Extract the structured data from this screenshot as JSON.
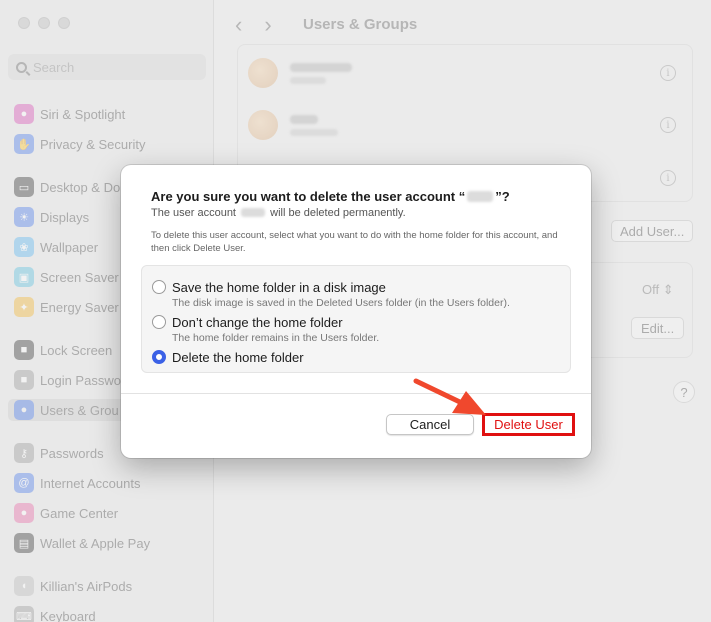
{
  "window": {
    "title": "Users & Groups"
  },
  "sidebar": {
    "search_placeholder": "Search",
    "items": [
      {
        "label": "Siri & Spotlight",
        "icon": "siri-icon",
        "color": "#d94fb5"
      },
      {
        "label": "Privacy & Security",
        "icon": "hand-icon",
        "color": "#4b7bec"
      },
      {
        "label": "Desktop & Do",
        "icon": "desktop-icon",
        "color": "#333333"
      },
      {
        "label": "Displays",
        "icon": "sun-icon",
        "color": "#4b7bec"
      },
      {
        "label": "Wallpaper",
        "icon": "wallpaper-icon",
        "color": "#5bb5f0"
      },
      {
        "label": "Screen Saver",
        "icon": "screensaver-icon",
        "color": "#5bc0de"
      },
      {
        "label": "Energy Saver",
        "icon": "bulb-icon",
        "color": "#f2b632"
      },
      {
        "label": "Lock Screen",
        "icon": "lock-icon",
        "color": "#333333"
      },
      {
        "label": "Login Passwo",
        "icon": "key-icon",
        "color": "#999999"
      },
      {
        "label": "Users & Grou",
        "icon": "users-icon",
        "color": "#4b7bec"
      },
      {
        "label": "Passwords",
        "icon": "key-icon",
        "color": "#999999"
      },
      {
        "label": "Internet Accounts",
        "icon": "at-icon",
        "color": "#4b7bec"
      },
      {
        "label": "Game Center",
        "icon": "game-center-icon",
        "color": "#e86aa5"
      },
      {
        "label": "Wallet & Apple Pay",
        "icon": "wallet-icon",
        "color": "#333333"
      },
      {
        "label": "Killian's AirPods",
        "icon": "airpods-icon",
        "color": "#bbbbbb"
      },
      {
        "label": "Keyboard",
        "icon": "keyboard-icon",
        "color": "#999999"
      }
    ]
  },
  "main": {
    "add_user_label": "Add User...",
    "off_label": "Off",
    "edit_label": "Edit...",
    "help_label": "?"
  },
  "dialog": {
    "title_prefix": "Are you sure you want to delete the user account “",
    "title_suffix": "”?",
    "subtitle_prefix": "The user account",
    "subtitle_suffix": "will be deleted permanently.",
    "description": "To delete this user account, select what you want to do with the home folder for this account, and then click Delete User.",
    "options": [
      {
        "label": "Save the home folder in a disk image",
        "hint": "The disk image is saved in the Deleted Users folder (in the Users folder).",
        "checked": false
      },
      {
        "label": "Don’t change the home folder",
        "hint": "The home folder remains in the Users folder.",
        "checked": false
      },
      {
        "label": "Delete the home folder",
        "hint": "",
        "checked": true
      }
    ],
    "cancel_label": "Cancel",
    "delete_label": "Delete User"
  },
  "colors": {
    "accent": "#3b61e6",
    "annotation": "#e01010",
    "arrow": "#f0482d"
  }
}
